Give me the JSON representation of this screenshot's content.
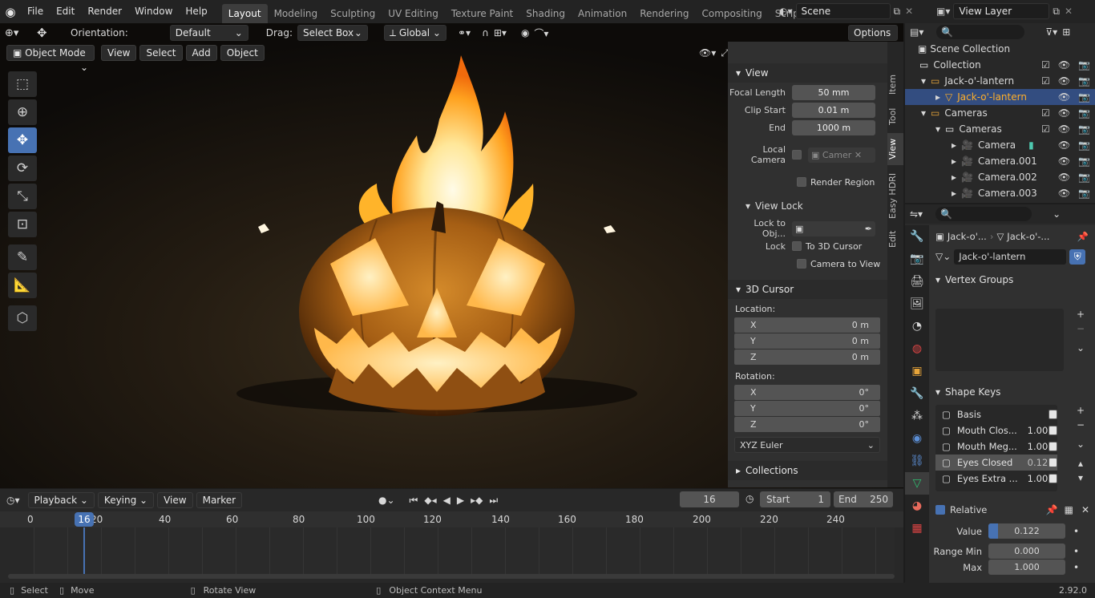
{
  "topbar": {
    "menus": [
      "File",
      "Edit",
      "Render",
      "Window",
      "Help"
    ],
    "workspaces": [
      "Layout",
      "Modeling",
      "Sculpting",
      "UV Editing",
      "Texture Paint",
      "Shading",
      "Animation",
      "Rendering",
      "Compositing",
      "Scripting"
    ],
    "add_workspace": "+",
    "scene_label": "Scene",
    "view_layer_label": "View Layer"
  },
  "tool_header": {
    "orientation_label": "Orientation:",
    "orientation_value": "Default",
    "drag_label": "Drag:",
    "drag_value": "Select Box",
    "transform_orientation": "Global",
    "options": "Options"
  },
  "viewport_header": {
    "mode": "Object Mode",
    "menus": [
      "View",
      "Select",
      "Add",
      "Object"
    ]
  },
  "npanel": {
    "view": {
      "title": "View",
      "focal_length_label": "Focal Length",
      "focal_length": "50 mm",
      "clip_start_label": "Clip Start",
      "clip_start": "0.01 m",
      "clip_end_label": "End",
      "clip_end": "1000 m",
      "local_camera_label": "Local Camera",
      "local_camera_value": "Camer",
      "render_region": "Render Region",
      "view_lock": "View Lock",
      "lock_to_obj": "Lock to Obj...",
      "lock_label": "Lock",
      "to_3d_cursor": "To 3D Cursor",
      "camera_to_view": "Camera to View"
    },
    "cursor": {
      "title": "3D Cursor",
      "location_label": "Location:",
      "rotation_label": "Rotation:",
      "loc": [
        {
          "axis": "X",
          "value": "0 m"
        },
        {
          "axis": "Y",
          "value": "0 m"
        },
        {
          "axis": "Z",
          "value": "0 m"
        }
      ],
      "rot": [
        {
          "axis": "X",
          "value": "0°"
        },
        {
          "axis": "Y",
          "value": "0°"
        },
        {
          "axis": "Z",
          "value": "0°"
        }
      ],
      "rot_mode": "XYZ Euler"
    },
    "collections_title": "Collections",
    "tabs": [
      "Item",
      "Tool",
      "View",
      "Easy HDRI",
      "Edit"
    ]
  },
  "timeline": {
    "menus": [
      "Playback",
      "Keying",
      "View",
      "Marker"
    ],
    "current_frame": "16",
    "start_label": "Start",
    "start": "1",
    "end_label": "End",
    "end": "250",
    "ruler": [
      "0",
      "20",
      "40",
      "60",
      "80",
      "100",
      "120",
      "140",
      "160",
      "180",
      "200",
      "220",
      "240"
    ],
    "playhead": "16"
  },
  "outliner": {
    "title": "Scene Collection",
    "rows": [
      {
        "label": "Collection"
      },
      {
        "label": "Jack-o'-lantern"
      },
      {
        "label": "Jack-o'-lantern"
      },
      {
        "label": "Cameras"
      },
      {
        "label": "Cameras"
      },
      {
        "label": "Camera"
      },
      {
        "label": "Camera.001"
      },
      {
        "label": "Camera.002"
      },
      {
        "label": "Camera.003"
      }
    ]
  },
  "properties": {
    "breadcrumb_obj": "Jack-o'...",
    "breadcrumb_data": "Jack-o'-...",
    "mesh_name": "Jack-o'-lantern",
    "vertex_groups_title": "Vertex Groups",
    "shape_keys_title": "Shape Keys",
    "shape_keys": [
      {
        "name": "Basis",
        "value": ""
      },
      {
        "name": "Mouth Clos...",
        "value": "1.00"
      },
      {
        "name": "Mouth Meg...",
        "value": "1.00"
      },
      {
        "name": "Eyes Closed",
        "value": "0.12"
      },
      {
        "name": "Eyes Extra ...",
        "value": "1.00"
      }
    ],
    "relative": "Relative",
    "value_label": "Value",
    "value": "0.122",
    "value_fill": 0.122,
    "range_min_label": "Range Min",
    "range_min": "0.000",
    "max_label": "Max",
    "max": "1.000"
  },
  "statusbar": {
    "select": "Select",
    "move": "Move",
    "rotate_view": "Rotate View",
    "context_menu": "Object Context Menu",
    "version": "2.92.0"
  },
  "colors": {
    "accent": "#4772b3",
    "selected_row": "#334d80",
    "active_object_text": "#ffaf29"
  }
}
